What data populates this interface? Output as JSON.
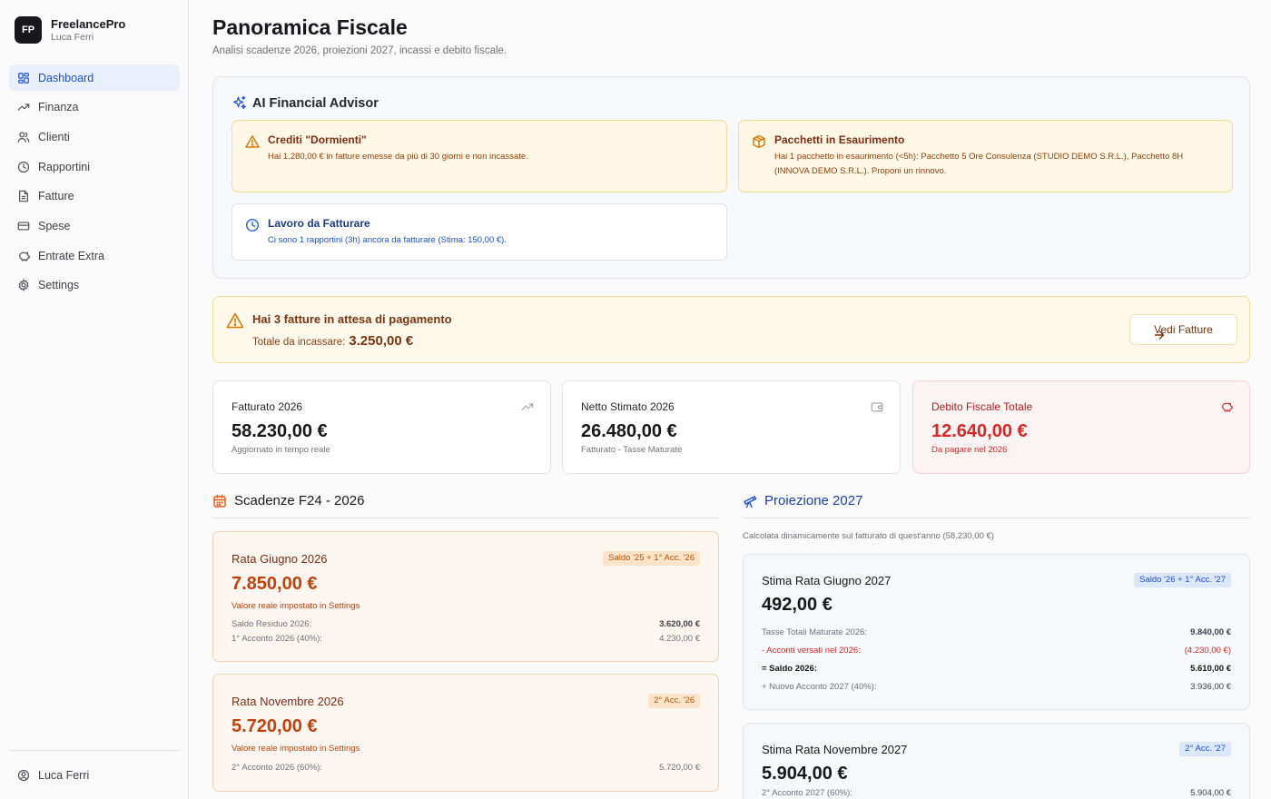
{
  "app": {
    "logo": "FP",
    "name": "FreelancePro",
    "user": "Luca Ferri"
  },
  "sidebar": {
    "items": [
      {
        "label": "Dashboard",
        "icon": "dashboard-grid-icon"
      },
      {
        "label": "Finanza",
        "icon": "trending-up-icon"
      },
      {
        "label": "Clienti",
        "icon": "users-icon"
      },
      {
        "label": "Rapportini",
        "icon": "clock-icon"
      },
      {
        "label": "Fatture",
        "icon": "file-text-icon"
      },
      {
        "label": "Spese",
        "icon": "credit-card-icon"
      },
      {
        "label": "Entrate Extra",
        "icon": "piggy-bank-icon"
      },
      {
        "label": "Settings",
        "icon": "gear-icon"
      }
    ],
    "footer_user": "Luca Ferri"
  },
  "header": {
    "title": "Panoramica Fiscale",
    "subtitle": "Analisi scadenze 2026, proiezioni 2027, incassi e debito fiscale."
  },
  "advisor": {
    "title": "AI Financial Advisor",
    "cards": [
      {
        "title": "Crediti \"Dormienti\"",
        "text": "Hai 1.280,00 € in fatture emesse da più di 30 giorni e non incassate.",
        "icon": "warning-triangle-icon"
      },
      {
        "title": "Pacchetti in Esaurimento",
        "text": "Hai 1 pacchetto in esaurimento (<5h): Pacchetto 5 Ore Consulenza (STUDIO DEMO S.R.L.), Pacchetto 8H (INNOVA DEMO S.R.L.). Proponi un rinnovo.",
        "icon": "package-icon"
      },
      {
        "title": "Lavoro da Fatturare",
        "text": "Ci sono 1 rapportini (3h) ancora da fatturare (Stima: 150,00 €).",
        "icon": "clock-icon"
      }
    ]
  },
  "pending": {
    "title": "Hai 3 fatture in attesa di pagamento",
    "total_label": "Totale da incassare:",
    "total_value": "3.250,00 €",
    "button": "Vedi Fatture"
  },
  "stats": [
    {
      "label": "Fatturato 2026",
      "value": "58.230,00 €",
      "sub": "Aggiornato in tempo reale",
      "icon": "trending-up-icon"
    },
    {
      "label": "Netto Stimato 2026",
      "value": "26.480,00 €",
      "sub": "Fatturato - Tasse Maturate",
      "icon": "wallet-icon"
    },
    {
      "label": "Debito Fiscale Totale",
      "value": "12.640,00 €",
      "sub": "Da pagare nel 2026",
      "icon": "piggy-bank-icon"
    }
  ],
  "scadenze": {
    "title": "Scadenze F24 - 2026",
    "rate": [
      {
        "title": "Rata Giugno 2026",
        "badge": "Saldo '25 + 1° Acc. '26",
        "value": "7.850,00 €",
        "note": "Valore reale impostato in Settings",
        "rows": [
          {
            "label": "Saldo Residuo 2026:",
            "value": "3.620,00 €"
          },
          {
            "label": "1° Acconto 2026 (40%):",
            "value": "4.230,00 €"
          }
        ]
      },
      {
        "title": "Rata Novembre 2026",
        "badge": "2° Acc. '26",
        "value": "5.720,00 €",
        "note": "Valore reale impostato in Settings",
        "rows": [
          {
            "label": "2° Acconto 2026 (60%):",
            "value": "5.720,00 €"
          }
        ]
      }
    ]
  },
  "proiezione": {
    "title": "Proiezione 2027",
    "subtitle": "Calcolata dinamicamente sul fatturato di quest'anno (58.230,00 €)",
    "stime": [
      {
        "title": "Stima Rata Giugno 2027",
        "badge": "Saldo '26 + 1° Acc. '27",
        "value": "492,00 €",
        "rows": [
          {
            "label": "Tasse Totali Maturate 2026:",
            "value": "9.840,00 €"
          },
          {
            "label": "- Acconti versati nel 2026:",
            "value": "(4.230,00 €)"
          },
          {
            "label": "= Saldo 2026:",
            "value": "5.610,00 €"
          },
          {
            "label": "+ Nuovo Acconto 2027 (40%):",
            "value": "3.936,00 €"
          }
        ]
      },
      {
        "title": "Stima Rata Novembre 2027",
        "badge": "2° Acc. '27",
        "value": "5.904,00 €",
        "rows": [
          {
            "label": "2° Acconto 2027 (60%):",
            "value": "5.904,00 €"
          }
        ]
      }
    ]
  },
  "colors": {
    "accent": "#1d4ed8",
    "warning": "#d97706",
    "danger": "#dc2626",
    "orange": "#c2410c"
  }
}
